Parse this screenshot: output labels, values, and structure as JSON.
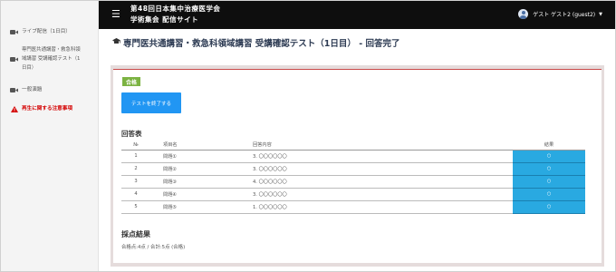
{
  "sidebar": {
    "live": "ライブ配信（1日目）",
    "course_lines": [
      "専門医共通講習・救急科領",
      "域講習 受講確認テスト（1",
      "日目）"
    ],
    "general": "一般演題",
    "caution": "再生に関する注意事項"
  },
  "header": {
    "menu_icon": "☰",
    "title_line1": "第48回日本集中治療医学会",
    "title_line2": "学術集会 配信サイト",
    "user_name": "ゲスト ゲスト2 (guest2)"
  },
  "page": {
    "title": "専門医共通講習・救急科領域講習 受講確認テスト（1日目） - 回答完了"
  },
  "result": {
    "badge": "合格",
    "finish_button": "テストを終了する"
  },
  "answers": {
    "title": "回答表",
    "headers": [
      "№",
      "項目名",
      "回答内容",
      "結果"
    ],
    "rows": [
      [
        "1",
        "問題①",
        "3. 〇〇〇〇〇〇",
        "○"
      ],
      [
        "2",
        "問題②",
        "3. 〇〇〇〇〇〇",
        "○"
      ],
      [
        "3",
        "問題③",
        "4. 〇〇〇〇〇〇",
        "○"
      ],
      [
        "4",
        "問題④",
        "3. 〇〇〇〇〇〇",
        "○"
      ],
      [
        "5",
        "問題⑤",
        "1. 〇〇〇〇〇〇",
        "○"
      ]
    ]
  },
  "score": {
    "title": "採点結果",
    "text": "合格点:4点 / 合計:5点 (合格)"
  },
  "colors": {
    "topbar": "#0e0e0e",
    "accent": "#c94a4a",
    "pass_badge": "#7cb342",
    "primary_button": "#2196f3",
    "result_cell": "#29a9e1",
    "alert_text": "#d40000"
  },
  "icons": {
    "live": "video-camera-icon",
    "course": "video-camera-icon",
    "general": "video-camera-icon",
    "caution": "warning-icon",
    "heading": "graduation-cap-icon",
    "user": "user-avatar-icon",
    "dropdown": "caret-down-icon"
  }
}
